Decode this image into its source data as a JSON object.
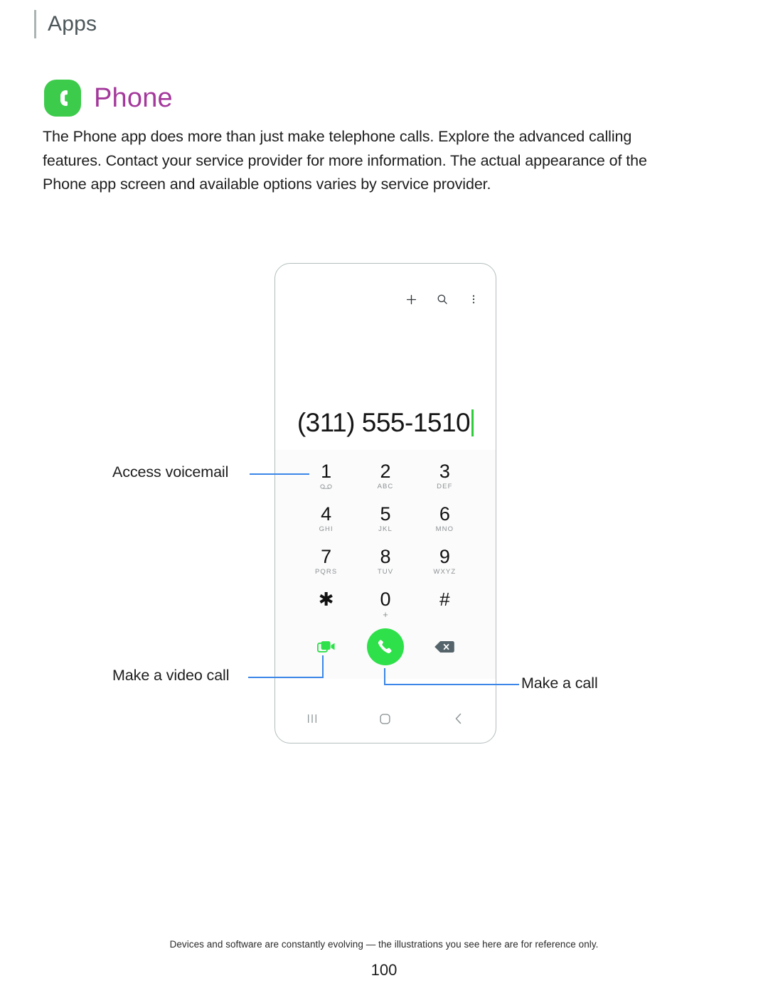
{
  "header": {
    "title": "Apps"
  },
  "section": {
    "title": "Phone",
    "icon": "phone-handset-icon",
    "icon_bg_color": "#3ccb4b",
    "title_color": "#a4399c",
    "intro": "The Phone app does more than just make telephone calls. Explore the advanced calling features. Contact your service provider for more information. The actual appearance of the Phone app screen and available options varies by service provider."
  },
  "phone_mock": {
    "topbar": {
      "icons": [
        {
          "name": "add-icon",
          "glyph": "plus"
        },
        {
          "name": "search-icon",
          "glyph": "magnifier"
        },
        {
          "name": "more-options-icon",
          "glyph": "vertical-dots"
        }
      ]
    },
    "dial_display": {
      "number": "(311) 555-1510",
      "cursor_color": "#2ecc38"
    },
    "keypad": [
      {
        "digit": "1",
        "sub": "",
        "sub_icon": "voicemail-icon"
      },
      {
        "digit": "2",
        "sub": "ABC",
        "sub_icon": ""
      },
      {
        "digit": "3",
        "sub": "DEF",
        "sub_icon": ""
      },
      {
        "digit": "4",
        "sub": "GHI",
        "sub_icon": ""
      },
      {
        "digit": "5",
        "sub": "JKL",
        "sub_icon": ""
      },
      {
        "digit": "6",
        "sub": "MNO",
        "sub_icon": ""
      },
      {
        "digit": "7",
        "sub": "PQRS",
        "sub_icon": ""
      },
      {
        "digit": "8",
        "sub": "TUV",
        "sub_icon": ""
      },
      {
        "digit": "9",
        "sub": "WXYZ",
        "sub_icon": ""
      },
      {
        "digit": "✱",
        "sub": "",
        "sub_icon": ""
      },
      {
        "digit": "0",
        "sub": "+",
        "sub_icon": ""
      },
      {
        "digit": "#",
        "sub": "",
        "sub_icon": ""
      }
    ],
    "actions": [
      {
        "name": "video-call-button",
        "icon": "video-camera-icon",
        "color": "#2ee04a"
      },
      {
        "name": "call-button",
        "icon": "phone-handset-icon",
        "color": "#2ee04a"
      },
      {
        "name": "backspace-button",
        "icon": "backspace-icon",
        "color": "#55646a"
      }
    ],
    "navbar": [
      {
        "name": "recents-button",
        "icon": "recents-bars-icon"
      },
      {
        "name": "home-button",
        "icon": "home-square-icon"
      },
      {
        "name": "back-button",
        "icon": "chevron-left-icon"
      }
    ]
  },
  "callouts": [
    {
      "label": "Access voicemail",
      "target": "key-1"
    },
    {
      "label": "Make a video call",
      "target": "video-call-button"
    },
    {
      "label": "Make a call",
      "target": "call-button"
    }
  ],
  "footer": {
    "note": "Devices and software are constantly evolving — the illustrations you see here are for reference only.",
    "page_number": "100"
  }
}
